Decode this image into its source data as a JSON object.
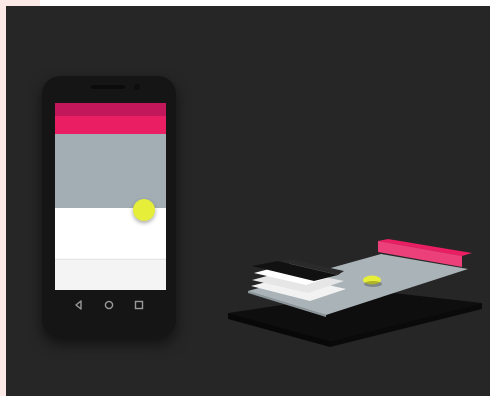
{
  "colors": {
    "background": "#262626",
    "frame": "#fbe9e7",
    "phone_body": "#151515",
    "status_bar": "#c2185b",
    "app_bar": "#e91e63",
    "hero": "#a2aeb3",
    "content": "#ffffff",
    "fab": "#e6ee3a"
  },
  "phone": {
    "nav_buttons": [
      "back-icon",
      "home-icon",
      "recents-icon"
    ]
  },
  "exploded_view": {
    "layers": [
      "base-shadow",
      "screen-surface",
      "content-sheet",
      "app-bar-layer",
      "fab-layer"
    ]
  }
}
